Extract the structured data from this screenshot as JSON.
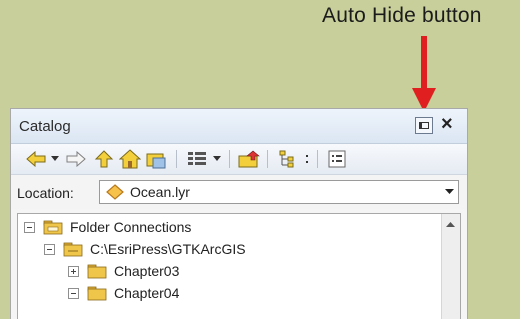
{
  "annotation": {
    "label": "Auto Hide button",
    "arrow_color": "#e02020"
  },
  "catalog": {
    "title": "Catalog",
    "location": {
      "label": "Location:",
      "value": "Ocean.lyr"
    },
    "tree": [
      {
        "label": "Folder Connections",
        "state": "expanded"
      },
      {
        "label": "C:\\EsriPress\\GTKArcGIS",
        "state": "expanded"
      },
      {
        "label": "Chapter03",
        "state": "collapsed"
      },
      {
        "label": "Chapter04",
        "state": "expanded"
      }
    ]
  },
  "colors": {
    "background": "#c8cf9a",
    "panel": "#f5f5f5",
    "titlebar": "#dbe6f3",
    "folder": "#f0c64a"
  }
}
